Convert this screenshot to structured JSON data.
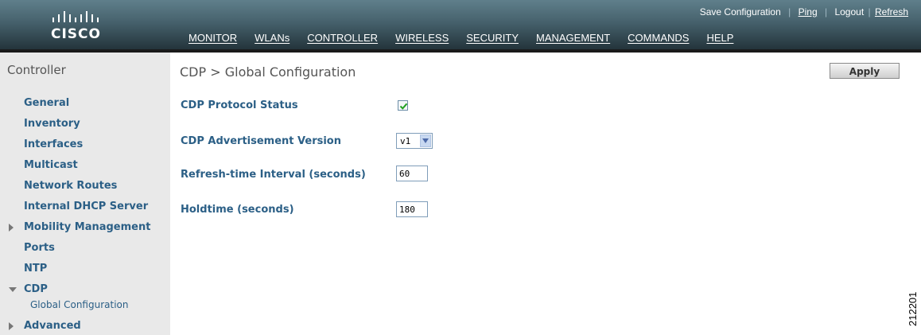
{
  "brand": {
    "logo_text": "CISCO"
  },
  "top_links": [
    {
      "label": "Save Configuration"
    },
    {
      "label": "Ping"
    },
    {
      "label": "Logout"
    },
    {
      "label": "Refresh"
    }
  ],
  "nav": [
    {
      "label": "MONITOR",
      "active": false
    },
    {
      "label": "WLANs",
      "active": false
    },
    {
      "label": "CONTROLLER",
      "active": true
    },
    {
      "label": "WIRELESS",
      "active": false
    },
    {
      "label": "SECURITY",
      "active": false
    },
    {
      "label": "MANAGEMENT",
      "active": false
    },
    {
      "label": "COMMANDS",
      "active": false
    },
    {
      "label": "HELP",
      "active": false
    }
  ],
  "sidebar": {
    "title": "Controller",
    "items": [
      {
        "label": "General"
      },
      {
        "label": "Inventory"
      },
      {
        "label": "Interfaces"
      },
      {
        "label": "Multicast"
      },
      {
        "label": "Network Routes"
      },
      {
        "label": "Internal DHCP Server"
      },
      {
        "label": "Mobility Management",
        "expandable": true,
        "expanded": false
      },
      {
        "label": "Ports"
      },
      {
        "label": "NTP"
      },
      {
        "label": "CDP",
        "expandable": true,
        "expanded": true
      },
      {
        "label": "Global Configuration"
      },
      {
        "label": "Advanced",
        "expandable": true,
        "expanded": false
      }
    ]
  },
  "main": {
    "title": "CDP > Global Configuration",
    "apply_label": "Apply",
    "fields": {
      "protocol_status": {
        "label": "CDP Protocol Status",
        "checked": true
      },
      "advertisement_version": {
        "label": "CDP Advertisement Version",
        "value": "v1"
      },
      "refresh_interval": {
        "label": "Refresh-time Interval (seconds)",
        "value": "60"
      },
      "holdtime": {
        "label": "Holdtime (seconds)",
        "value": "180"
      }
    }
  },
  "figure_id": "212201",
  "colors": {
    "header_top": "#5f7f8b",
    "header_bottom": "#24343b",
    "active_tab_underline": "#f07800",
    "link_blue": "#2b5f86",
    "sidebar_bg": "#e9e9e9"
  }
}
